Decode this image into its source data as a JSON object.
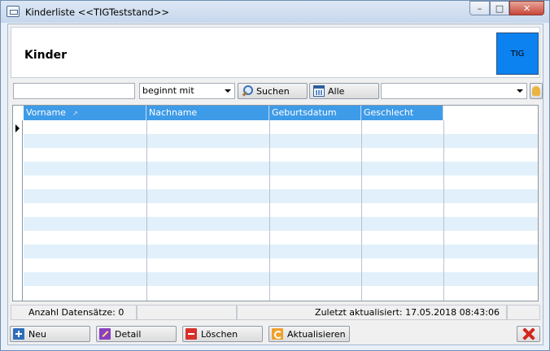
{
  "window": {
    "title": "Kinderliste  <<TIGTeststand>>",
    "minimize_glyph": "–",
    "maximize_glyph": "□",
    "close_glyph": "✕"
  },
  "header": {
    "title": "Kinder",
    "logo_text": "TIG",
    "logo_color": "#0c82f0"
  },
  "filter": {
    "search_value": "",
    "mode_value": "beginnt mit",
    "search_button": "Suchen",
    "all_button": "Alle",
    "extra_combo_value": ""
  },
  "grid": {
    "header_color": "#3e9be8",
    "alt_row_color": "#e1f0fb",
    "columns": [
      {
        "label": "Vorname",
        "sorted": true
      },
      {
        "label": "Nachname"
      },
      {
        "label": "Geburtsdatum"
      },
      {
        "label": "Geschlecht"
      }
    ],
    "sort_icon_glyph": "↗",
    "rows": []
  },
  "status": {
    "count_text": "Anzahl Datensätze: 0",
    "updated_text": "Zuletzt aktualisiert: 17.05.2018 08:43:06"
  },
  "actions": {
    "new": "Neu",
    "detail": "Detail",
    "delete": "Löschen",
    "refresh": "Aktualisieren"
  }
}
